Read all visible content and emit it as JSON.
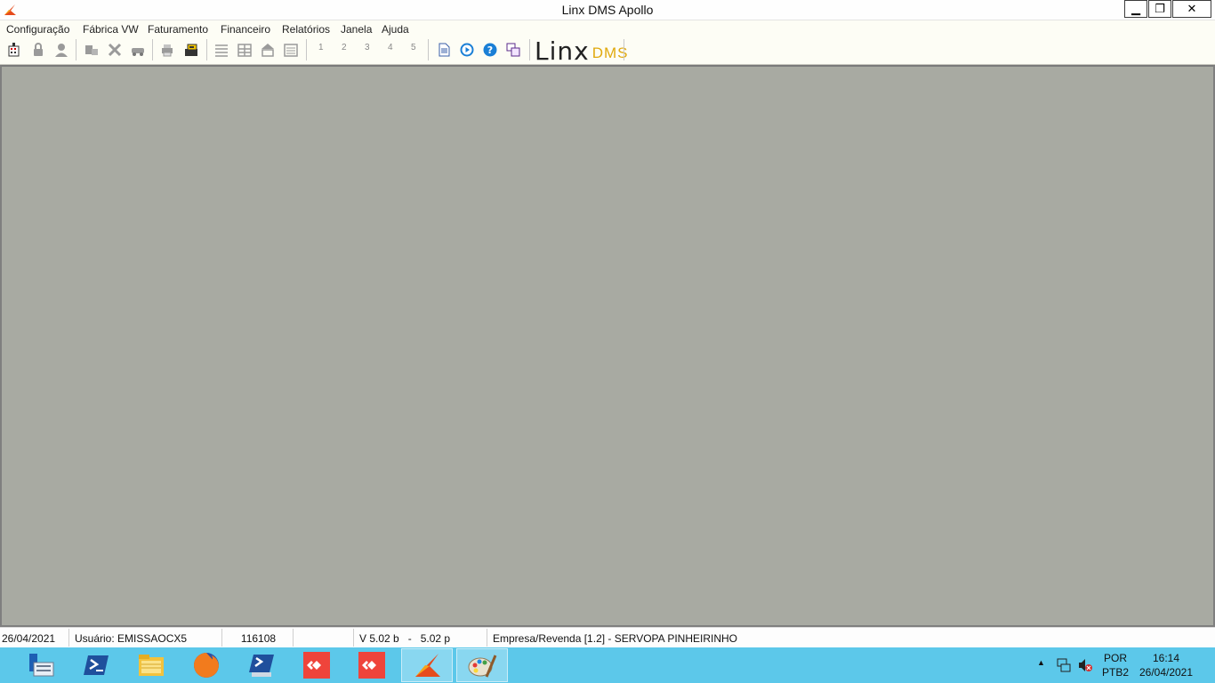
{
  "window": {
    "title": "Linx DMS Apollo",
    "minimize_label": "▁",
    "maximize_label": "❐",
    "close_label": "✕"
  },
  "menu": {
    "items": [
      "Configuração",
      "Fábrica VW",
      "Faturamento",
      "Financeiro",
      "Relatórios",
      "Janela",
      "Ajuda"
    ]
  },
  "toolbar": {
    "numbers": [
      "1",
      "2",
      "3",
      "4",
      "5"
    ],
    "logo": {
      "word": "Linx",
      "suffix": "DMS"
    },
    "colors": {
      "accent_yellow": "#e0a90e",
      "disabled_gray": "#9a9a9a",
      "help_blue": "#1a7fd6"
    }
  },
  "status": {
    "date": "26/04/2021",
    "user": "Usuário: EMISSAOCX5",
    "code": "116108",
    "empty": "",
    "version": "V 5.02 b   -   5.02 p",
    "company": "Empresa/Revenda [1.2] - SERVOPA PINHEIRINHO"
  },
  "taskbar": {
    "apps": [
      "server-manager",
      "powershell",
      "file-explorer",
      "firefox",
      "powershell-ise",
      "anydesk",
      "anydesk",
      "linx-dms-apollo",
      "paint"
    ],
    "tray": {
      "language": "POR",
      "keyboard": "PTB2",
      "time": "16:14",
      "date": "26/04/2021",
      "show_hidden_label": "▲"
    }
  },
  "colors": {
    "mdi_background": "#a8aaa2",
    "taskbar": "#5cc8ea",
    "chrome": "#fdfdf5"
  }
}
